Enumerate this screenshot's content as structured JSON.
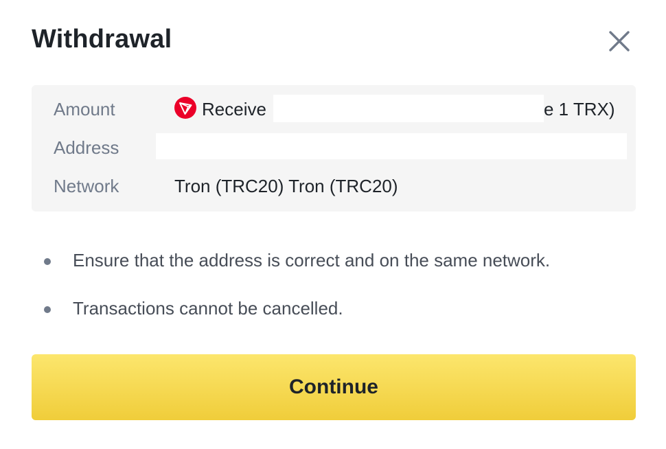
{
  "modal": {
    "title": "Withdrawal",
    "close_icon": "close-icon"
  },
  "summary": {
    "amount": {
      "label": "Amount",
      "coin_icon": "tron-icon",
      "value_prefix": "Receive",
      "value_suffix": "e 1 TRX)"
    },
    "address": {
      "label": "Address",
      "value": ""
    },
    "network": {
      "label": "Network",
      "value": "Tron (TRC20) Tron (TRC20)"
    }
  },
  "notes": [
    "Ensure that the address is correct and on the same network.",
    "Transactions cannot be cancelled."
  ],
  "actions": {
    "continue_label": "Continue"
  },
  "colors": {
    "primary_button": "#f0cd3a",
    "tron_red": "#eb0029",
    "label_gray": "#707a8a",
    "panel_bg": "#f5f5f5"
  }
}
